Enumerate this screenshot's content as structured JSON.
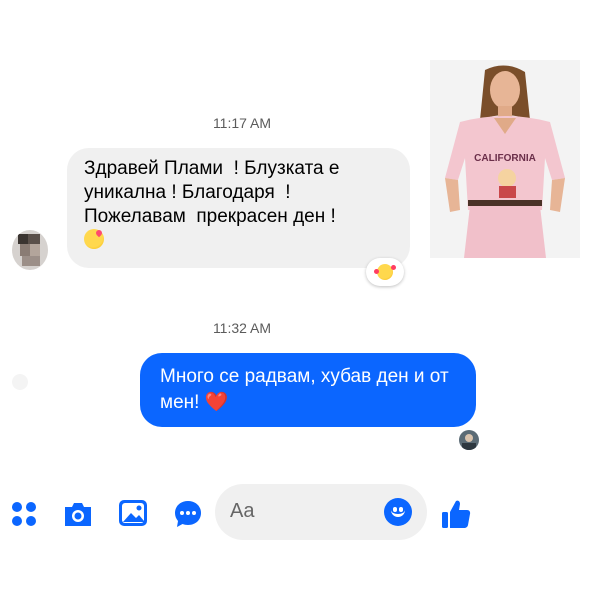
{
  "conversation": {
    "timestamp_1": "11:17 AM",
    "incoming_message": "Здравей Плами  ! Блузката е уникална ! Благодаря  ! Пожелавам  прекрасен ден !",
    "reaction_icon": "smiling-face-with-hearts-icon",
    "timestamp_2": "11:32 AM",
    "outgoing_message": "Много се радвам, хубав ден и от мен!",
    "outgoing_emoji": "❤️"
  },
  "photo": {
    "shirt_text": "CALIFORNIA"
  },
  "composer": {
    "placeholder": "Aa",
    "icons": [
      "menu-dots-icon",
      "camera-icon",
      "image-icon",
      "chat-bubble-icon",
      "emoji-icon",
      "thumbs-up-icon"
    ]
  },
  "colors": {
    "accent": "#0b66ff",
    "incoming_bubble": "#f0f0f0",
    "outgoing_bubble": "#0b66ff"
  }
}
